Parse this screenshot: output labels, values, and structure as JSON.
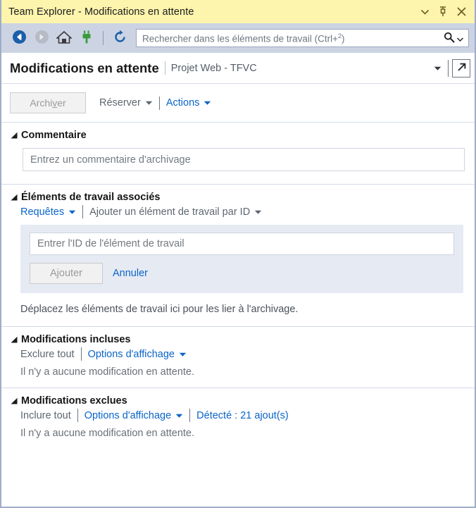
{
  "window": {
    "title": "Team Explorer - Modifications en attente",
    "buttons": [
      {
        "name": "window-menu-button",
        "icon": "chevron-down-icon"
      },
      {
        "name": "pin-button",
        "icon": "pin-icon"
      },
      {
        "name": "close-button",
        "icon": "close-icon"
      }
    ]
  },
  "toolbar": {
    "icons": [
      {
        "name": "back-button",
        "icon": "back-arrow-icon",
        "enabled": "true"
      },
      {
        "name": "forward-button",
        "icon": "forward-arrow-icon",
        "enabled": "false"
      },
      {
        "name": "home-button",
        "icon": "home-icon",
        "enabled": "true"
      },
      {
        "name": "connect-button",
        "icon": "plug-icon",
        "enabled": "true"
      },
      {
        "name": "refresh-button",
        "icon": "refresh-icon",
        "enabled": "true"
      }
    ],
    "search": {
      "placeholder_prefix": "Rechercher dans les éléments de travail (Ctrl+",
      "placeholder_sup": "2",
      "placeholder_suffix": ")",
      "value": ""
    }
  },
  "header": {
    "title": "Modifications en attente",
    "subtitle": "Projet Web - TFVC",
    "chevron": "chevron-down-icon",
    "popout": "open-in-new-window-icon"
  },
  "actionbar": {
    "checkin_label_a": "Archi",
    "checkin_label_accel": "v",
    "checkin_label_b": "er",
    "shelve_label": "Réserver",
    "actions_label": "Actions"
  },
  "sections": {
    "comment": {
      "title": "Commentaire",
      "input_placeholder": "Entrez un commentaire d'archivage",
      "input_value": ""
    },
    "workitems": {
      "title": "Éléments de travail associés",
      "queries_label": "Requêtes",
      "add_by_id_label": "Ajouter un élément de travail par ID",
      "id_input_placeholder": "Entrer l'ID de l'élément de travail",
      "id_input_value": "",
      "add_button_label": "Ajouter",
      "cancel_link_label": "Annuler",
      "drag_hint": "Déplacez les éléments de travail ici pour les lier à l'archivage."
    },
    "included": {
      "title": "Modifications incluses",
      "exclude_all_label": "Exclure tout",
      "view_options_label": "Options d'affichage",
      "empty_text": "Il n'y a aucune modification en attente."
    },
    "excluded": {
      "title": "Modifications exclues",
      "include_all_label": "Inclure tout",
      "view_options_label": "Options d'affichage",
      "detected_label": "Détecté : 21 ajout(s)",
      "empty_text": "Il n'y a aucune modification en attente."
    }
  },
  "colors": {
    "titlebar_bg": "#FDF4AD",
    "toolbar_bg": "#CCD4E4",
    "link_blue": "#0A64C8",
    "panel_bg": "#E6EAF3",
    "window_border": "#9FADC8",
    "plug_green": "#3C9B3C"
  }
}
